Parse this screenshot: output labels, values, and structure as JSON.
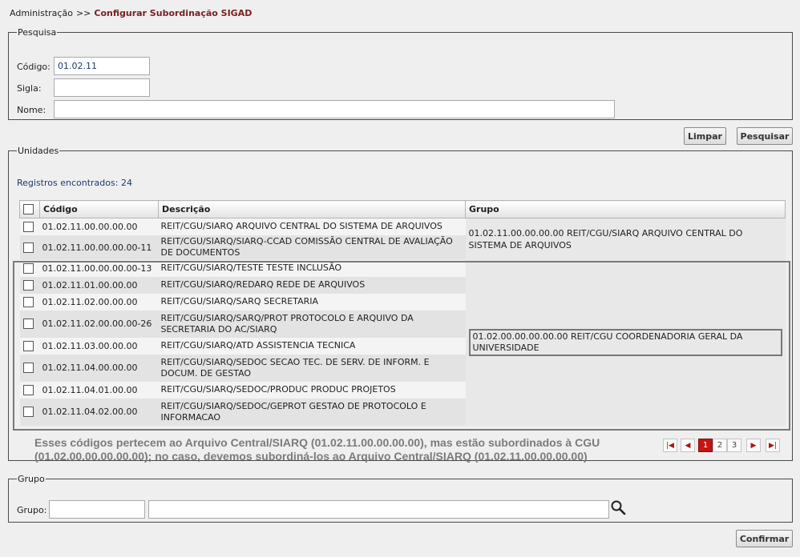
{
  "breadcrumb": {
    "root": "Administração",
    "separator": ">>",
    "current": "Configurar Subordinação SIGAD"
  },
  "search": {
    "legend": "Pesquisa",
    "codigo_label": "Código:",
    "codigo_value": "01.02.11",
    "sigla_label": "Sigla:",
    "sigla_value": "",
    "nome_label": "Nome:",
    "nome_value": ""
  },
  "actions": {
    "clear": "Limpar",
    "search": "Pesquisar"
  },
  "units": {
    "legend": "Unidades",
    "found": "Registros encontrados: 24",
    "columns": [
      "Código",
      "Descrição",
      "Grupo"
    ],
    "rows": [
      {
        "code": "01.02.11.00.00.00.00",
        "desc": "REIT/CGU/SIARQ ARQUIVO CENTRAL DO SISTEMA DE ARQUIVOS"
      },
      {
        "code": "01.02.11.00.00.00.00-11",
        "desc": "REIT/CGU/SIARQ/SIARQ-CCAD COMISSÃO CENTRAL DE AVALIAÇÃO DE DOCUMENTOS"
      },
      {
        "code": "01.02.11.00.00.00.00-13",
        "desc": "REIT/CGU/SIARQ/TESTE TESTE INCLUSÃO"
      },
      {
        "code": "01.02.11.01.00.00.00",
        "desc": "REIT/CGU/SIARQ/REDARQ REDE DE ARQUIVOS"
      },
      {
        "code": "01.02.11.02.00.00.00",
        "desc": "REIT/CGU/SIARQ/SARQ SECRETARIA"
      },
      {
        "code": "01.02.11.02.00.00.00-26",
        "desc": "REIT/CGU/SIARQ/SARQ/PROT PROTOCOLO E ARQUIVO DA SECRETARIA DO AC/SIARQ"
      },
      {
        "code": "01.02.11.03.00.00.00",
        "desc": "REIT/CGU/SIARQ/ATD ASSISTENCIA TECNICA"
      },
      {
        "code": "01.02.11.04.00.00.00",
        "desc": "REIT/CGU/SIARQ/SEDOC SECAO TEC. DE SERV. DE INFORM. E DOCUM. DE GESTAO"
      },
      {
        "code": "01.02.11.04.01.00.00",
        "desc": "REIT/CGU/SIARQ/SEDOC/PRODUC PRODUC PROJETOS"
      },
      {
        "code": "01.02.11.04.02.00.00",
        "desc": "REIT/CGU/SIARQ/SEDOC/GEPROT GESTAO DE PROTOCOLO E INFORMACAO"
      }
    ],
    "groups": [
      "01.02.11.00.00.00.00 REIT/CGU/SIARQ ARQUIVO CENTRAL DO SISTEMA DE ARQUIVOS",
      "01.02.00.00.00.00.00 REIT/CGU COORDENADORIA GERAL DA UNIVERSIDADE"
    ],
    "annotation": "Esses códigos pertecem ao Arquivo Central/SIARQ (01.02.11.00.00.00.00), mas estão subordinados à CGU (01.02.00.00.00.00.00); no caso, devemos subordiná-los ao Arquivo Central/SIARQ (01.02.11.00.00.00.00)",
    "pagination": {
      "pages": [
        "1",
        "2",
        "3"
      ],
      "current": "1"
    }
  },
  "grupo": {
    "legend": "Grupo",
    "label": "Grupo:",
    "code_value": "",
    "name_value": ""
  },
  "confirm": "Confirmar",
  "colors": {
    "accent": "#7a2020",
    "page_active": "#c41414"
  },
  "icons": [
    "first-page-icon",
    "prev-page-icon",
    "next-page-icon",
    "last-page-icon",
    "search-icon"
  ]
}
